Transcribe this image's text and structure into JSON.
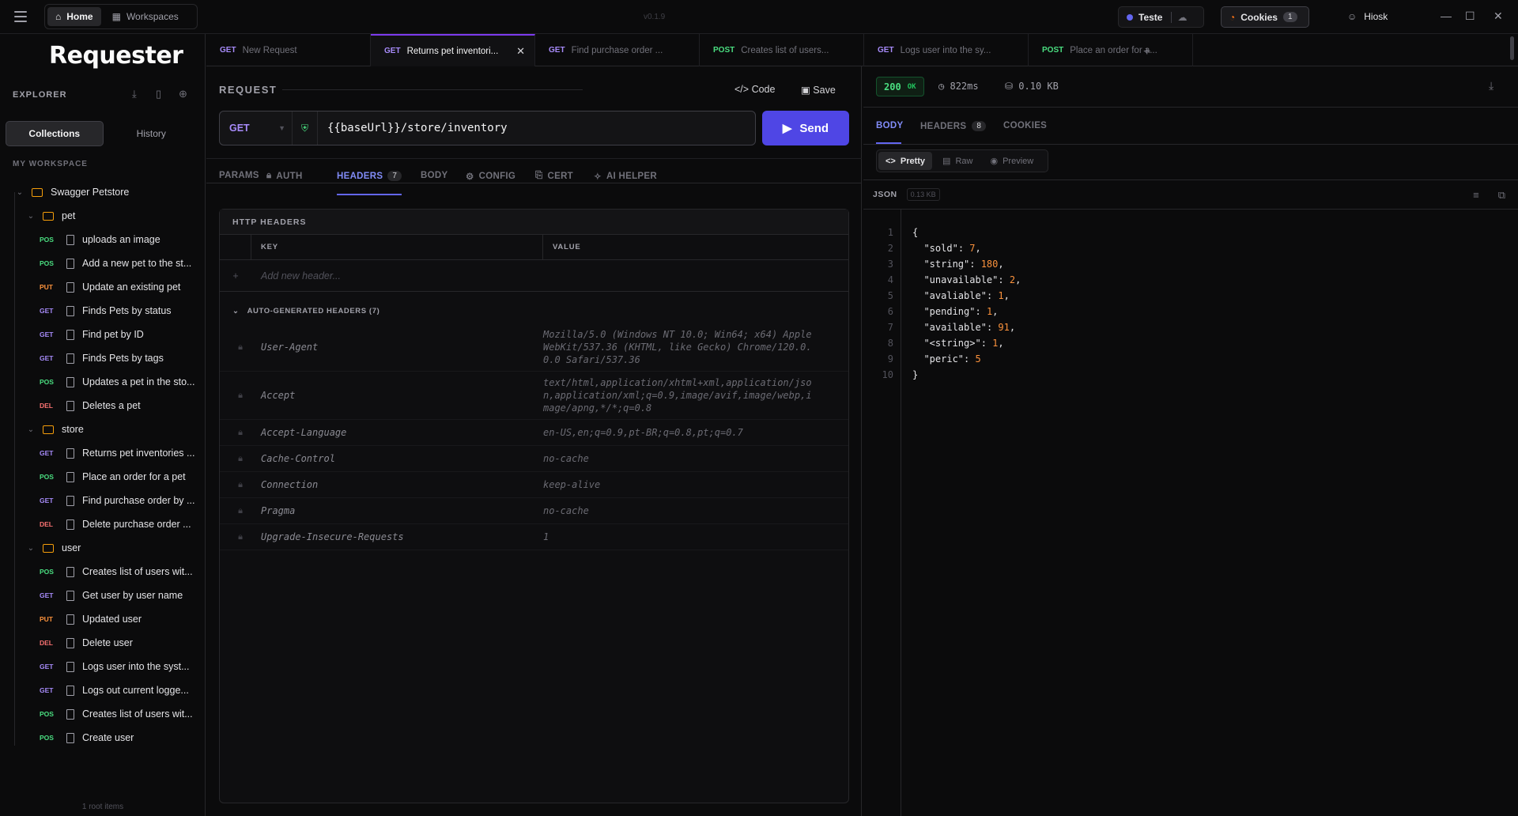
{
  "titlebar": {
    "home_label": "Home",
    "workspaces_label": "Workspaces",
    "version": "v0.1.9",
    "environment_label": "Teste",
    "cookies_label": "Cookies",
    "cookies_count": "1",
    "user_name": "Hiosk"
  },
  "sidebar": {
    "logo": "Requester",
    "explorer_label": "EXPLORER",
    "collections_tab": "Collections",
    "history_tab": "History",
    "workspace_label": "MY WORKSPACE",
    "collection_name": "Swagger Petstore",
    "folders": [
      {
        "name": "pet",
        "items": [
          {
            "method": "POS",
            "label": "uploads an image"
          },
          {
            "method": "POS",
            "label": "Add a new pet to the st..."
          },
          {
            "method": "PUT",
            "label": "Update an existing pet"
          },
          {
            "method": "GET",
            "label": "Finds Pets by status"
          },
          {
            "method": "GET",
            "label": "Find pet by ID"
          },
          {
            "method": "GET",
            "label": "Finds Pets by tags"
          },
          {
            "method": "POS",
            "label": "Updates a pet in the sto..."
          },
          {
            "method": "DEL",
            "label": "Deletes a pet"
          }
        ]
      },
      {
        "name": "store",
        "items": [
          {
            "method": "GET",
            "label": "Returns pet inventories ..."
          },
          {
            "method": "POS",
            "label": "Place an order for a pet"
          },
          {
            "method": "GET",
            "label": "Find purchase order by ..."
          },
          {
            "method": "DEL",
            "label": "Delete purchase order ..."
          }
        ]
      },
      {
        "name": "user",
        "items": [
          {
            "method": "POS",
            "label": "Creates list of users wit..."
          },
          {
            "method": "GET",
            "label": "Get user by user name"
          },
          {
            "method": "PUT",
            "label": "Updated user"
          },
          {
            "method": "DEL",
            "label": "Delete user"
          },
          {
            "method": "GET",
            "label": "Logs user into the syst..."
          },
          {
            "method": "GET",
            "label": "Logs out current logge..."
          },
          {
            "method": "POS",
            "label": "Creates list of users wit..."
          },
          {
            "method": "POS",
            "label": "Create user"
          }
        ]
      }
    ],
    "root_items": "1 root items"
  },
  "tabs": [
    {
      "method": "GET",
      "label": "New Request",
      "active": false
    },
    {
      "method": "GET",
      "label": "Returns pet inventori...",
      "active": true
    },
    {
      "method": "GET",
      "label": "Find purchase order ...",
      "active": false
    },
    {
      "method": "POST",
      "label": "Creates list of users...",
      "active": false
    },
    {
      "method": "GET",
      "label": "Logs user into the sy...",
      "active": false
    },
    {
      "method": "POST",
      "label": "Place an order for a...",
      "active": false
    }
  ],
  "request": {
    "title": "REQUEST",
    "code_label": "Code",
    "save_label": "Save",
    "method": "GET",
    "url": "{{baseUrl}}/store/inventory",
    "send_label": "Send",
    "subtabs": {
      "params": "PARAMS",
      "auth": "AUTH",
      "headers": "HEADERS",
      "headers_count": "7",
      "body": "BODY",
      "config": "CONFIG",
      "cert": "CERT",
      "ai_helper": "AI HELPER"
    },
    "headers_panel": {
      "title": "HTTP HEADERS",
      "key_col": "KEY",
      "value_col": "VALUE",
      "add_placeholder": "Add new header...",
      "auto_title": "AUTO-GENERATED HEADERS (7)",
      "rows": [
        {
          "key": "User-Agent",
          "value": "Mozilla/5.0 (Windows NT 10.0; Win64; x64) AppleWebKit/537.36 (KHTML, like Gecko) Chrome/120.0.0.0 Safari/537.36"
        },
        {
          "key": "Accept",
          "value": "text/html,application/xhtml+xml,application/json,application/xml;q=0.9,image/avif,image/webp,image/apng,*/*;q=0.8"
        },
        {
          "key": "Accept-Language",
          "value": "en-US,en;q=0.9,pt-BR;q=0.8,pt;q=0.7"
        },
        {
          "key": "Cache-Control",
          "value": "no-cache"
        },
        {
          "key": "Connection",
          "value": "keep-alive"
        },
        {
          "key": "Pragma",
          "value": "no-cache"
        },
        {
          "key": "Upgrade-Insecure-Requests",
          "value": "1"
        }
      ]
    }
  },
  "response": {
    "status_code": "200",
    "status_text": "OK",
    "time": "822ms",
    "size": "0.10 KB",
    "tabs": {
      "body": "BODY",
      "headers": "HEADERS",
      "headers_count": "8",
      "cookies": "COOKIES"
    },
    "views": {
      "pretty": "Pretty",
      "raw": "Raw",
      "preview": "Preview"
    },
    "format_label": "JSON",
    "format_size": "0.13 KB",
    "lines": [
      {
        "n": "1",
        "key": "",
        "value": "",
        "text": "{"
      },
      {
        "n": "2",
        "key": "\"sold\"",
        "value": "7",
        "text": ""
      },
      {
        "n": "3",
        "key": "\"string\"",
        "value": "180",
        "text": ""
      },
      {
        "n": "4",
        "key": "\"unavailable\"",
        "value": "2",
        "text": ""
      },
      {
        "n": "5",
        "key": "\"avaliable\"",
        "value": "1",
        "text": ""
      },
      {
        "n": "6",
        "key": "\"pending\"",
        "value": "1",
        "text": ""
      },
      {
        "n": "7",
        "key": "\"available\"",
        "value": "91",
        "text": ""
      },
      {
        "n": "8",
        "key": "\"<string>\"",
        "value": "1",
        "text": ""
      },
      {
        "n": "9",
        "key": "\"peric\"",
        "value": "5",
        "text": ""
      },
      {
        "n": "10",
        "key": "",
        "value": "",
        "text": "}"
      }
    ]
  },
  "colors": {
    "accent": "#6366f1",
    "get": "#a78bfa",
    "post": "#4ade80",
    "put": "#fb923c",
    "delete": "#f87171"
  }
}
